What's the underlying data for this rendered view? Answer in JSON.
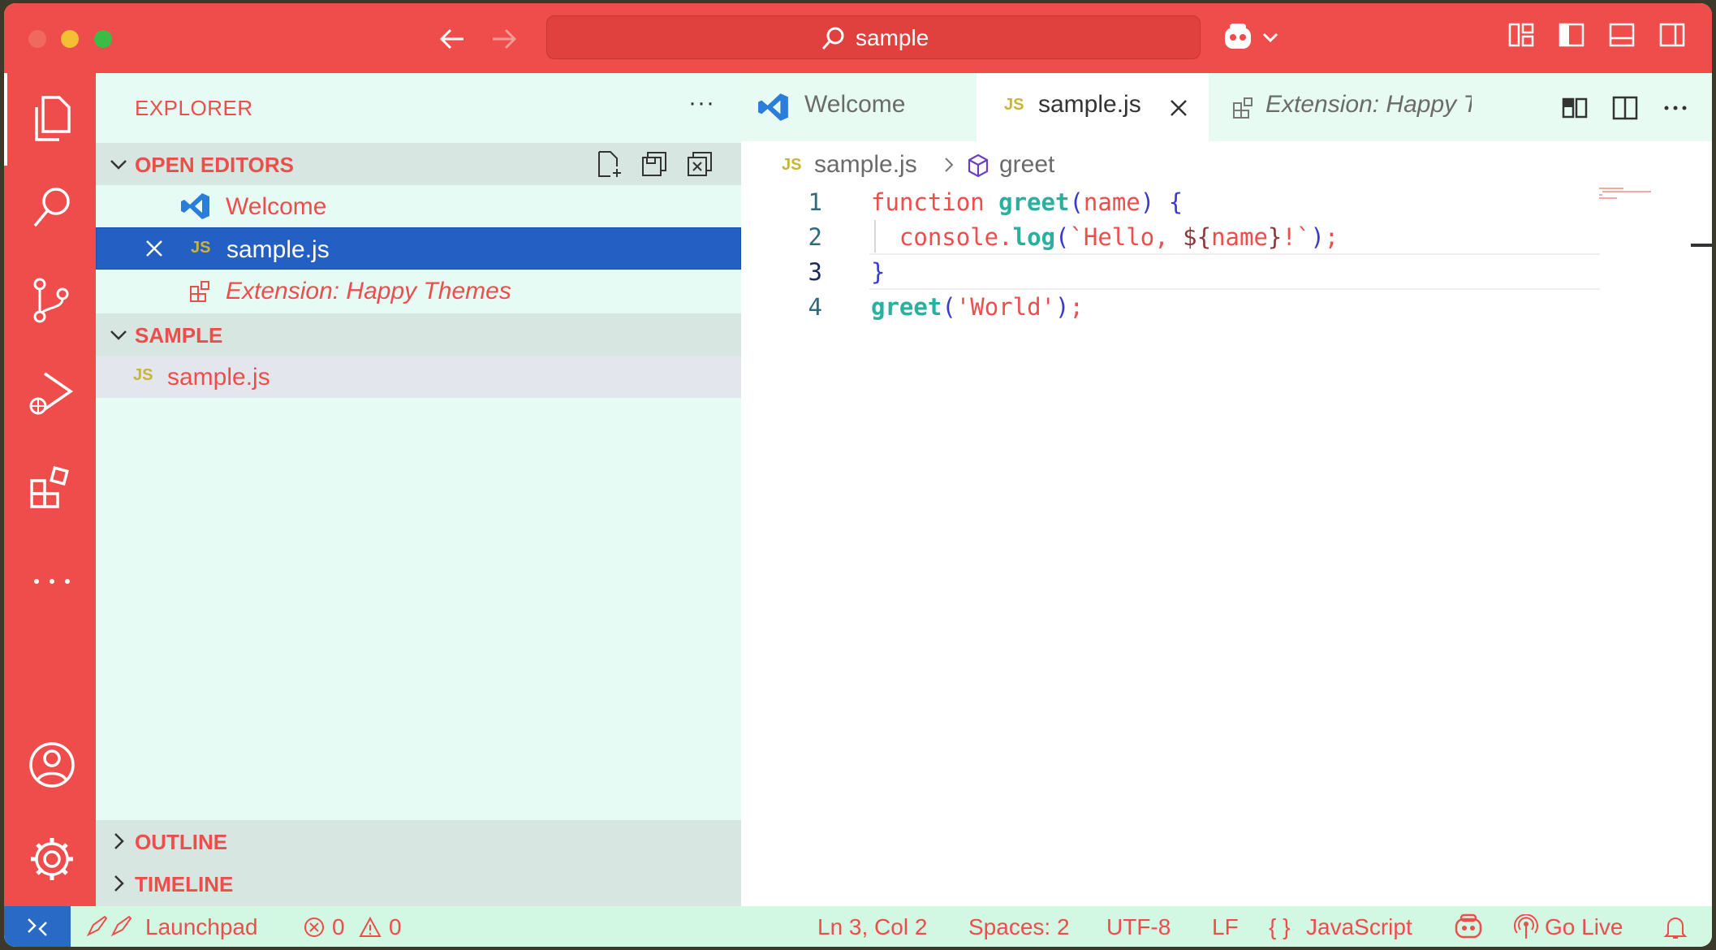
{
  "titlebar": {
    "search_text": "sample"
  },
  "sidebar": {
    "title": "EXPLORER",
    "more": "···",
    "open_editors": {
      "header": "OPEN EDITORS",
      "items": [
        {
          "label": "Welcome"
        },
        {
          "label": "sample.js",
          "badge": "JS"
        },
        {
          "label": "Extension: Happy Themes"
        }
      ]
    },
    "folder": {
      "header": "SAMPLE",
      "files": [
        {
          "label": "sample.js",
          "badge": "JS"
        }
      ]
    },
    "outline": "OUTLINE",
    "timeline": "TIMELINE"
  },
  "editor": {
    "tabs": [
      {
        "label": "Welcome"
      },
      {
        "label": "sample.js",
        "badge": "JS"
      },
      {
        "label": "Extension: Happy Themes"
      }
    ],
    "breadcrumb": {
      "file": "sample.js",
      "file_badge": "JS",
      "symbol": "greet"
    },
    "lines": [
      {
        "n": "1"
      },
      {
        "n": "2"
      },
      {
        "n": "3"
      },
      {
        "n": "4"
      }
    ],
    "code": {
      "l1_kw": "function ",
      "l1_fn": "greet",
      "l1_p1": "(",
      "l1_arg": "name",
      "l1_p2": ")",
      "l1_br": " {",
      "l2_a": "  console.",
      "l2_log": "log",
      "l2_p1": "(",
      "l2_str1": "`Hello, ",
      "l2_tpl1": "${",
      "l2_var": "name",
      "l2_tpl2": "}",
      "l2_str2": "!`",
      "l2_p2": ")",
      "l2_semi": ";",
      "l3": "}",
      "l4_fn": "greet",
      "l4_p1": "(",
      "l4_str": "'World'",
      "l4_p2": ")",
      "l4_semi": ";"
    }
  },
  "statusbar": {
    "launchpad": "Launchpad",
    "errors": "0",
    "warnings": "0",
    "position": "Ln 3, Col 2",
    "spaces": "Spaces: 2",
    "encoding": "UTF-8",
    "eol": "LF",
    "language_braces": "{ }",
    "language": "JavaScript",
    "go_live": "Go Live"
  },
  "colors": {
    "accent": "#ef4d4b",
    "sidebar_bg": "#e6fbf3",
    "selection": "#2460c4",
    "status_bg": "#d2f8e4"
  }
}
